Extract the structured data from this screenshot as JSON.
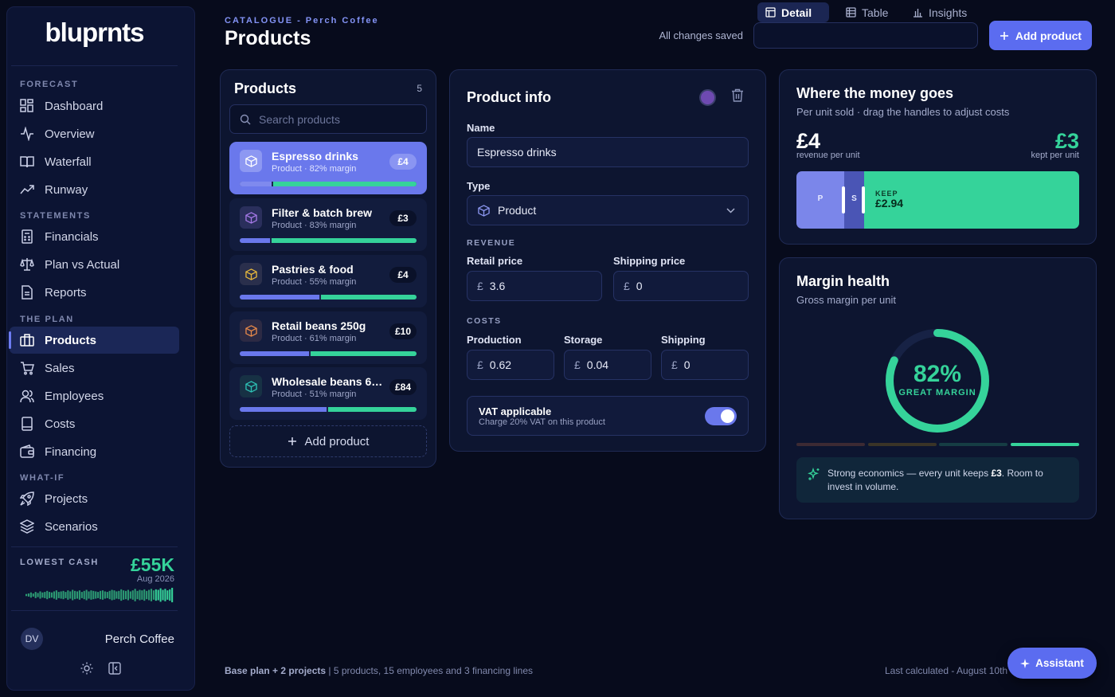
{
  "sidebar": {
    "logo": "bluprnts",
    "sections": {
      "forecast": "FORECAST",
      "statements": "STATEMENTS",
      "the_plan": "THE PLAN",
      "what_if": "WHAT-IF"
    },
    "items": [
      {
        "label": "Dashboard",
        "icon": "grid-icon"
      },
      {
        "label": "Overview",
        "icon": "pulse-icon"
      },
      {
        "label": "Waterfall",
        "icon": "book-icon"
      },
      {
        "label": "Runway",
        "icon": "trend-icon"
      },
      {
        "label": "Financials",
        "icon": "calculator-icon"
      },
      {
        "label": "Plan vs Actual",
        "icon": "scale-icon"
      },
      {
        "label": "Reports",
        "icon": "file-icon"
      },
      {
        "label": "Products",
        "icon": "briefcase-icon",
        "active": true
      },
      {
        "label": "Sales",
        "icon": "cart-icon"
      },
      {
        "label": "Employees",
        "icon": "users-icon"
      },
      {
        "label": "Costs",
        "icon": "ledger-icon"
      },
      {
        "label": "Financing",
        "icon": "wallet-icon"
      },
      {
        "label": "Projects",
        "icon": "rocket-icon"
      },
      {
        "label": "Scenarios",
        "icon": "layers-icon"
      }
    ],
    "lowest_cash": {
      "label": "LOWEST CASH",
      "value": "£55K",
      "date": "Aug 2026"
    },
    "user": {
      "initials": "DV",
      "org": "Perch Coffee"
    }
  },
  "header": {
    "breadcrumb": "CATALOGUE - Perch Coffee",
    "title": "Products",
    "saved": "All changes saved",
    "views": [
      "Detail",
      "Table",
      "Insights"
    ],
    "active_view": "Detail",
    "add_button": "Add product"
  },
  "products_panel": {
    "title": "Products",
    "count": "5",
    "search_placeholder": "Search products",
    "items": [
      {
        "name": "Espresso drinks",
        "sub": "Product · 82% margin",
        "price": "£4",
        "icon_color": "#ffffff",
        "margin": 0.82
      },
      {
        "name": "Filter & batch brew",
        "sub": "Product · 83% margin",
        "price": "£3",
        "icon_color": "#a679e8",
        "margin": 0.83
      },
      {
        "name": "Pastries & food",
        "sub": "Product · 55% margin",
        "price": "£4",
        "icon_color": "#e8b93c",
        "margin": 0.55
      },
      {
        "name": "Retail beans 250g",
        "sub": "Product · 61% margin",
        "price": "£10",
        "icon_color": "#e98a4a",
        "margin": 0.61
      },
      {
        "name": "Wholesale beans 6…",
        "sub": "Product · 51% margin",
        "price": "£84",
        "icon_color": "#2ec4b6",
        "margin": 0.51
      }
    ],
    "add_label": "Add product"
  },
  "product_info": {
    "title": "Product info",
    "name_label": "Name",
    "name_value": "Espresso drinks",
    "type_label": "Type",
    "type_value": "Product",
    "revenue_section": "REVENUE",
    "retail_label": "Retail price",
    "retail_value": "3.6",
    "shipping_price_label": "Shipping price",
    "shipping_price_value": "0",
    "costs_section": "COSTS",
    "production_label": "Production",
    "production_value": "0.62",
    "storage_label": "Storage",
    "storage_value": "0.04",
    "shipping_label": "Shipping",
    "shipping_value": "0",
    "currency": "£",
    "vat_title": "VAT applicable",
    "vat_sub": "Charge 20% VAT on this product",
    "vat_on": true,
    "accent_color": "#6e4ab1"
  },
  "money": {
    "title": "Where the money goes",
    "subtitle": "Per unit sold · drag the handles to adjust costs",
    "revenue": "£4",
    "revenue_label": "revenue per unit",
    "kept": "£3",
    "kept_label": "kept per unit",
    "segments": [
      {
        "label": "P",
        "share": 0.17,
        "color": "#7b86ea"
      },
      {
        "label": "S",
        "share": 0.07,
        "color": "#4a55b5"
      },
      {
        "label": "KEEP",
        "value": "£2.94",
        "share": 0.76,
        "color": "#35d39a"
      }
    ]
  },
  "margin": {
    "title": "Margin health",
    "subtitle": "Gross margin per unit",
    "percent": "82%",
    "percent_value": 0.82,
    "rating": "GREAT MARGIN",
    "note_prefix": "Strong economics — every unit keeps ",
    "note_bold": "£3",
    "note_suffix": ". Room to invest in volume."
  },
  "footer": {
    "plan": "Base plan + 2 projects",
    "summary": " | 5 products, 15 employees and 3 financing lines",
    "calculated": "Last calculated - August 10th",
    "assistant": "Assistant"
  },
  "colors": {
    "accent": "#5b6cf0",
    "success": "#35d39a",
    "background": "#070b1c"
  }
}
